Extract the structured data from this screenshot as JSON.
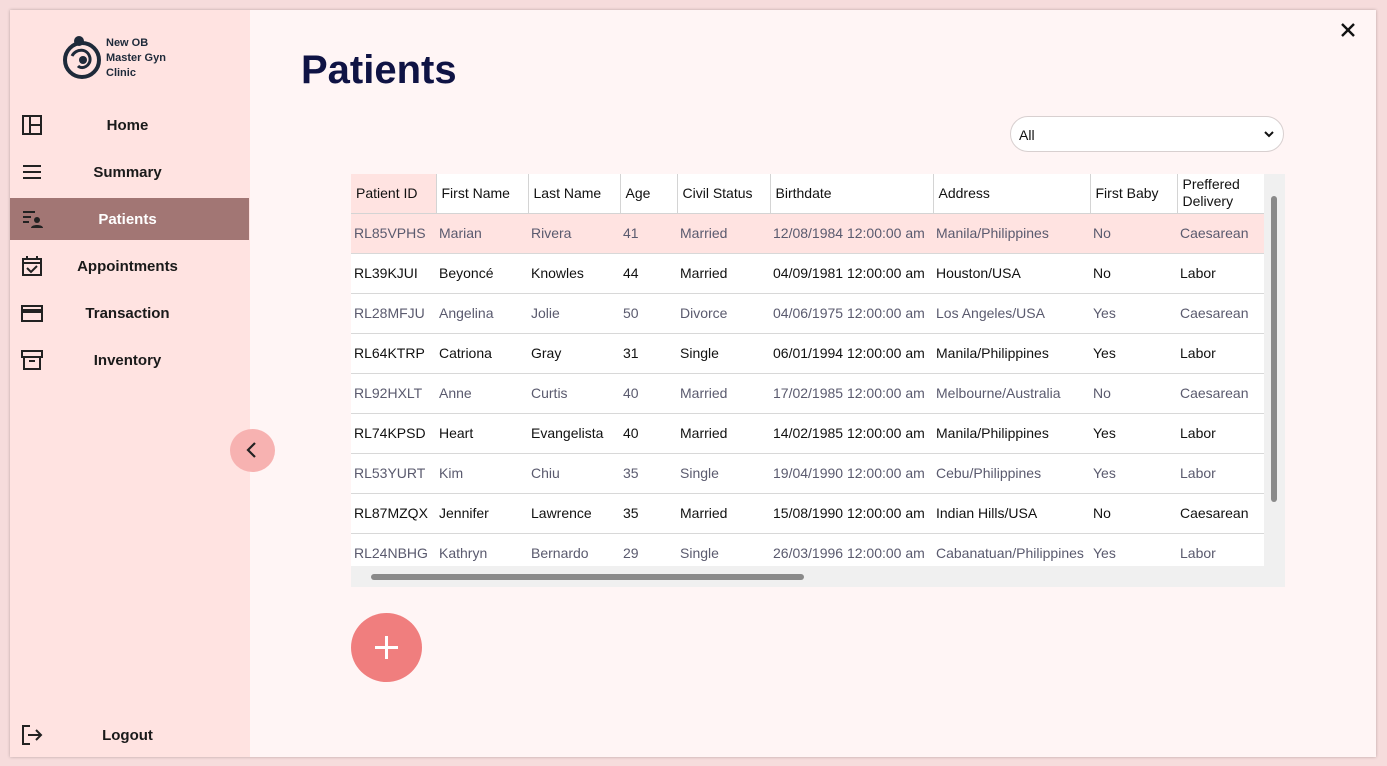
{
  "app": {
    "name_lines": [
      "New OB",
      "Master Gyn",
      "Clinic"
    ]
  },
  "sidebar": {
    "items": [
      {
        "label": "Home",
        "icon": "dashboard-icon"
      },
      {
        "label": "Summary",
        "icon": "menu-icon"
      },
      {
        "label": "Patients",
        "icon": "patient-list-icon",
        "active": true
      },
      {
        "label": "Appointments",
        "icon": "calendar-check-icon"
      },
      {
        "label": "Transaction",
        "icon": "credit-card-icon"
      },
      {
        "label": "Inventory",
        "icon": "archive-icon"
      }
    ],
    "logout_label": "Logout"
  },
  "main": {
    "title": "Patients",
    "filter": {
      "selected": "All"
    }
  },
  "table": {
    "columns": [
      "Patient ID",
      "First Name",
      "Last Name",
      "Age",
      "Civil Status",
      "Birthdate",
      "Address",
      "First Baby",
      "Preffered Delivery"
    ],
    "rows": [
      [
        "RL85VPHS",
        "Marian",
        "Rivera",
        "41",
        "Married",
        "12/08/1984 12:00:00 am",
        "Manila/Philippines",
        "No",
        "Caesarean"
      ],
      [
        "RL39KJUI",
        "Beyoncé",
        "Knowles",
        "44",
        "Married",
        "04/09/1981 12:00:00 am",
        "Houston/USA",
        "No",
        "Labor"
      ],
      [
        "RL28MFJU",
        "Angelina",
        "Jolie",
        "50",
        "Divorce",
        "04/06/1975 12:00:00 am",
        "Los Angeles/USA",
        "Yes",
        "Caesarean"
      ],
      [
        "RL64KTRP",
        "Catriona",
        "Gray",
        "31",
        "Single",
        "06/01/1994 12:00:00 am",
        "Manila/Philippines",
        "Yes",
        "Labor"
      ],
      [
        "RL92HXLT",
        "Anne",
        "Curtis",
        "40",
        "Married",
        "17/02/1985 12:00:00 am",
        "Melbourne/Australia",
        "No",
        "Caesarean"
      ],
      [
        "RL74KPSD",
        "Heart",
        "Evangelista",
        "40",
        "Married",
        "14/02/1985 12:00:00 am",
        "Manila/Philippines",
        "Yes",
        "Labor"
      ],
      [
        "RL53YURT",
        "Kim",
        "Chiu",
        "35",
        "Single",
        "19/04/1990 12:00:00 am",
        "Cebu/Philippines",
        "Yes",
        "Labor"
      ],
      [
        "RL87MZQX",
        "Jennifer",
        "Lawrence",
        "35",
        "Married",
        "15/08/1990 12:00:00 am",
        "Indian Hills/USA",
        "No",
        "Caesarean"
      ],
      [
        "RL24NBHG",
        "Kathryn",
        "Bernardo",
        "29",
        "Single",
        "26/03/1996 12:00:00 am",
        "Cabanatuan/Philippines",
        "Yes",
        "Labor"
      ]
    ],
    "selected_row": 0
  },
  "colors": {
    "sidebar_bg": "#ffe3e1",
    "active_item": "#a27674",
    "title": "#0f1344",
    "add_button": "#f07e7e",
    "collapse_button": "#f7b2b1"
  }
}
